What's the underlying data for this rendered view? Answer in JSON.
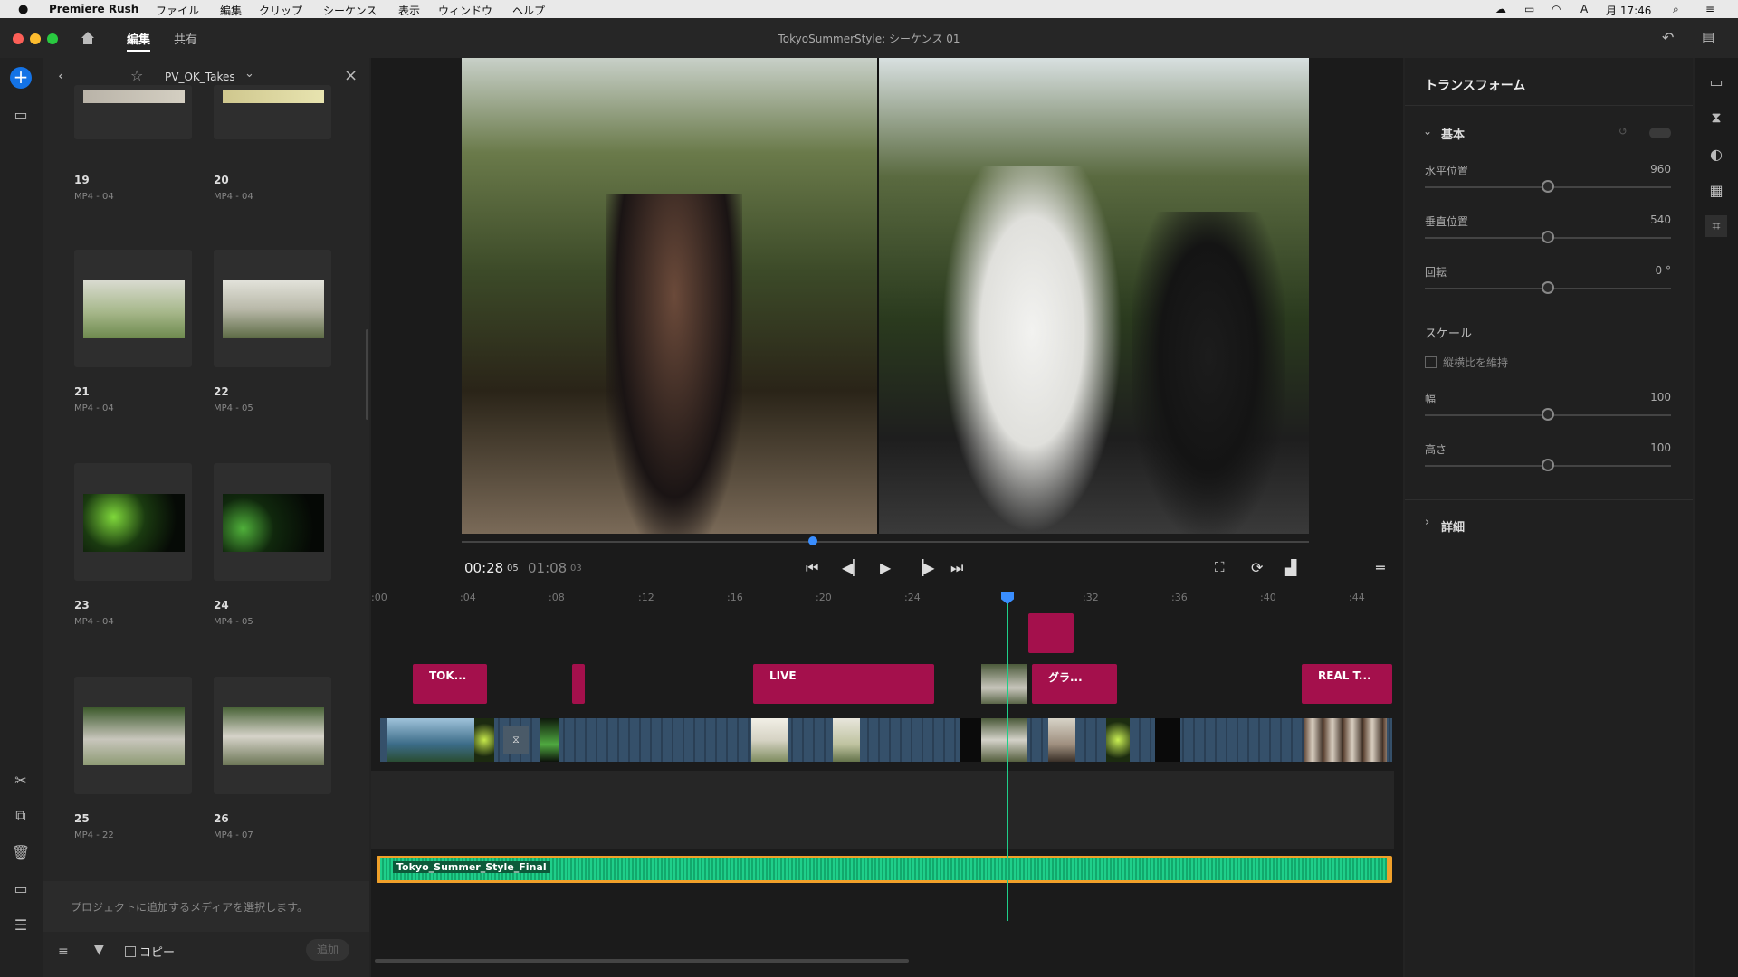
{
  "menubar": {
    "apple": "",
    "app_name": "Premiere Rush",
    "items": [
      "ファイル",
      "編集",
      "クリップ",
      "シーケンス",
      "表示",
      "ウィンドウ",
      "ヘルプ"
    ],
    "clock": "月 17:46"
  },
  "titlebar": {
    "tabs": [
      "編集",
      "共有"
    ],
    "title": "TokyoSummerStyle: シーケンス 01"
  },
  "media": {
    "folder": "PV_OK_Takes",
    "items": [
      {
        "num": "19",
        "meta": "MP4 - 04"
      },
      {
        "num": "20",
        "meta": "MP4 - 04"
      },
      {
        "num": "21",
        "meta": "MP4 - 04"
      },
      {
        "num": "22",
        "meta": "MP4 - 05"
      },
      {
        "num": "23",
        "meta": "MP4 - 04"
      },
      {
        "num": "24",
        "meta": "MP4 - 05"
      },
      {
        "num": "25",
        "meta": "MP4 - 22"
      },
      {
        "num": "26",
        "meta": "MP4 - 07"
      }
    ],
    "hint": "プロジェクトに追加するメディアを選択します。",
    "copy_label": "コピー",
    "add_label": "追加"
  },
  "player": {
    "current": "00:28",
    "current_frames": "05",
    "duration": "01:08",
    "duration_frames": "03"
  },
  "timeline": {
    "ruler": [
      ":00",
      ":04",
      ":08",
      ":12",
      ":16",
      ":20",
      ":24",
      ":32",
      ":36",
      ":40",
      ":44"
    ],
    "title_clips": [
      "TOK...",
      "LIVE",
      "グラ...",
      "REAL T..."
    ],
    "audio_clip": "Tokyo_Summer_Style_Final"
  },
  "transform": {
    "heading": "トランスフォーム",
    "basic_label": "基本",
    "position_x_label": "水平位置",
    "position_x_value": "960",
    "position_y_label": "垂直位置",
    "position_y_value": "540",
    "rotation_label": "回転",
    "rotation_value": "0 °",
    "scale_label": "スケール",
    "keep_aspect_label": "縦横比を維持",
    "width_label": "幅",
    "width_value": "100",
    "height_label": "高さ",
    "height_value": "100",
    "detail_label": "詳細"
  }
}
